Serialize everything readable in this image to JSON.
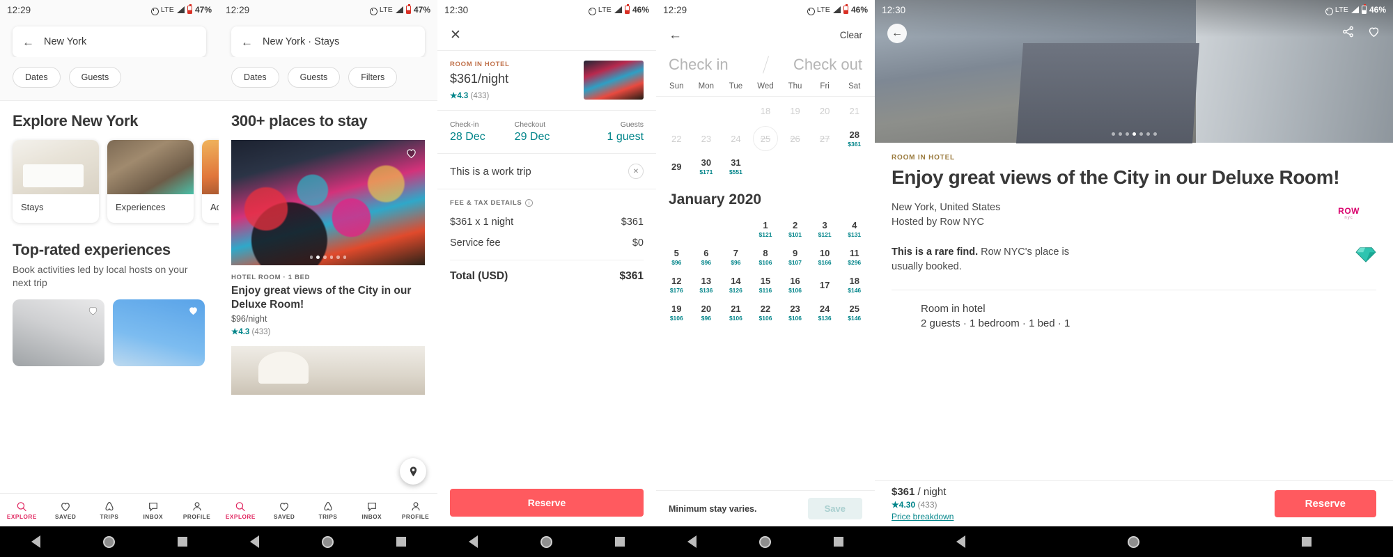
{
  "panels": [
    {
      "status": {
        "time": "12:29",
        "network": "LTE",
        "battery": "47%"
      },
      "search": {
        "value": "New York",
        "back_icon": "arrow-left-icon"
      },
      "chips": [
        "Dates",
        "Guests"
      ],
      "explore_heading": "Explore New York",
      "category_cards": [
        {
          "label": "Stays"
        },
        {
          "label": "Experiences"
        },
        {
          "label": "Adventures"
        }
      ],
      "section_heading": "Top-rated experiences",
      "section_sub": "Book activities led by local hosts on your next trip"
    },
    {
      "status": {
        "time": "12:29",
        "network": "LTE",
        "battery": "47%"
      },
      "search": {
        "value": "New York · Stays"
      },
      "chips": [
        "Dates",
        "Guests",
        "Filters"
      ],
      "results_heading": "300+ places to stay",
      "listing": {
        "kind": "HOTEL ROOM · 1 BED",
        "title": "Enjoy great views of the City in our Deluxe Room!",
        "price": "$96/night",
        "rating": "4.3",
        "reviews": "(433)",
        "star": "★"
      },
      "map_button_icon": "map-pin-icon"
    },
    {
      "status": {
        "time": "12:30",
        "network": "LTE",
        "battery": "46%"
      },
      "close_icon": "close-icon",
      "summary": {
        "kind": "ROOM IN HOTEL",
        "price": "$361/night",
        "star": "★",
        "rating": "4.3",
        "reviews": "(433)"
      },
      "trip": [
        {
          "label": "Check-in",
          "value": "28 Dec"
        },
        {
          "label": "Checkout",
          "value": "29 Dec"
        },
        {
          "label": "Guests",
          "value": "1 guest"
        }
      ],
      "work_trip": {
        "label": "This is a work trip",
        "remove_icon": "close-icon"
      },
      "fees_header": "FEE & TAX DETAILS",
      "fees": [
        {
          "label": "$361 x 1 night",
          "value": "$361"
        },
        {
          "label": "Service fee",
          "value": "$0"
        }
      ],
      "total": {
        "label": "Total (USD)",
        "value": "$361"
      },
      "cta": "Reserve"
    },
    {
      "status": {
        "time": "12:29",
        "network": "LTE",
        "battery": "46%"
      },
      "back_icon": "arrow-left-icon",
      "clear": "Clear",
      "checkin_placeholder": "Check in",
      "checkout_placeholder": "Check out",
      "weekdays": [
        "Sun",
        "Mon",
        "Tue",
        "Wed",
        "Thu",
        "Fri",
        "Sat"
      ],
      "december": {
        "leading_blanks": 3,
        "days": [
          {
            "n": "18",
            "disabled": true
          },
          {
            "n": "19",
            "disabled": true
          },
          {
            "n": "20",
            "disabled": true
          },
          {
            "n": "21",
            "disabled": true
          },
          {
            "n": "22",
            "disabled": true
          },
          {
            "n": "23",
            "disabled": true
          },
          {
            "n": "24",
            "disabled": true
          },
          {
            "n": "25",
            "disabled": true,
            "strike": true,
            "today": true
          },
          {
            "n": "26",
            "disabled": true,
            "strike": true
          },
          {
            "n": "27",
            "disabled": true,
            "strike": true
          },
          {
            "n": "28",
            "price": "$361"
          },
          {
            "n": "29"
          },
          {
            "n": "30",
            "price": "$171"
          },
          {
            "n": "31",
            "price": "$551"
          }
        ]
      },
      "january": {
        "title": "January 2020",
        "leading_blanks": 3,
        "days": [
          {
            "n": "1",
            "price": "$121"
          },
          {
            "n": "2",
            "price": "$101"
          },
          {
            "n": "3",
            "price": "$121"
          },
          {
            "n": "4",
            "price": "$131"
          },
          {
            "n": "5",
            "price": "$96"
          },
          {
            "n": "6",
            "price": "$96"
          },
          {
            "n": "7",
            "price": "$96"
          },
          {
            "n": "8",
            "price": "$106"
          },
          {
            "n": "9",
            "price": "$107"
          },
          {
            "n": "10",
            "price": "$166"
          },
          {
            "n": "11",
            "price": "$296"
          },
          {
            "n": "12",
            "price": "$176"
          },
          {
            "n": "13",
            "price": "$136"
          },
          {
            "n": "14",
            "price": "$126"
          },
          {
            "n": "15",
            "price": "$116"
          },
          {
            "n": "16",
            "price": "$106"
          },
          {
            "n": "17"
          },
          {
            "n": "18",
            "price": "$146"
          },
          {
            "n": "19",
            "price": "$106"
          },
          {
            "n": "20",
            "price": "$96"
          },
          {
            "n": "21",
            "price": "$106"
          },
          {
            "n": "22",
            "price": "$106"
          },
          {
            "n": "23",
            "price": "$106"
          },
          {
            "n": "24",
            "price": "$136"
          },
          {
            "n": "25",
            "price": "$146"
          }
        ]
      },
      "footer": {
        "note": "Minimum stay varies.",
        "save": "Save"
      }
    },
    {
      "status": {
        "time": "12:30",
        "network": "LTE",
        "battery": "46%"
      },
      "back_icon": "arrow-left-icon",
      "share_icon": "share-icon",
      "favorite_icon": "heart-icon",
      "kind": "ROOM IN HOTEL",
      "title": "Enjoy great views of the City in our Deluxe Room!",
      "location": "New York, United States",
      "host": "Hosted by Row NYC",
      "host_logo": {
        "name": "ROW",
        "sub": "nyc"
      },
      "rare_bold": "This is a rare find.",
      "rare_rest": " Row NYC's place is usually booked.",
      "rare_icon": "gem-icon",
      "room_type": "Room in hotel",
      "room_specs": "2 guests · 1 bedroom · 1 bed · 1",
      "footer": {
        "price": "$361",
        "per": " / night",
        "star": "★",
        "rating": "4.30",
        "reviews": "(433)",
        "breakdown": "Price breakdown",
        "cta": "Reserve"
      }
    }
  ],
  "bottom_nav": {
    "items": [
      {
        "label": "EXPLORE",
        "icon": "search-icon",
        "active": true
      },
      {
        "label": "SAVED",
        "icon": "heart-icon",
        "active": false
      },
      {
        "label": "TRIPS",
        "icon": "airbnb-belo-icon",
        "active": false
      },
      {
        "label": "INBOX",
        "icon": "chat-bubble-icon",
        "active": false
      },
      {
        "label": "PROFILE",
        "icon": "person-icon",
        "active": false
      }
    ],
    "accent": "#e0245e"
  },
  "android_nav": {
    "back": "back-triangle-icon",
    "home": "home-circle-icon",
    "recents": "recents-square-icon"
  },
  "colors": {
    "accent": "#ff5a5f",
    "teal": "#008489",
    "nav_active": "#e0245e"
  }
}
